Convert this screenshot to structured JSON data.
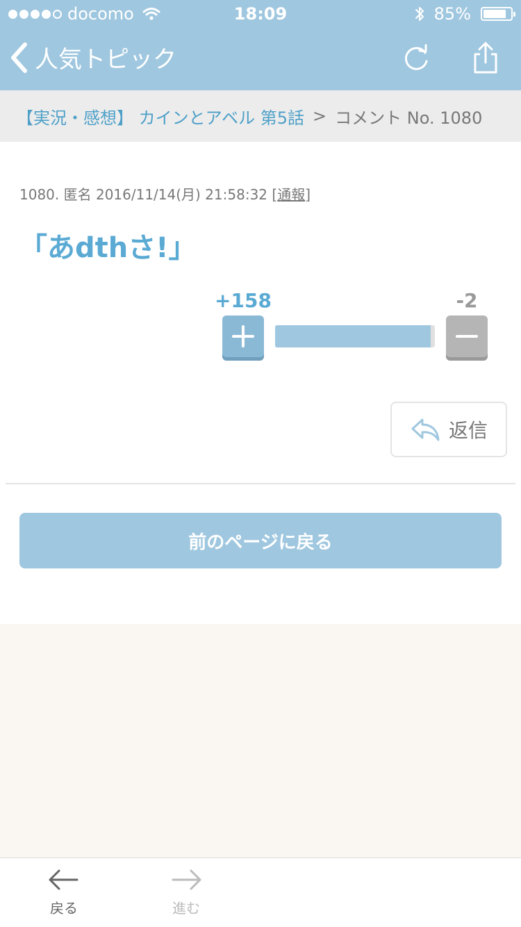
{
  "status_bar": {
    "carrier": "docomo",
    "time": "18:09",
    "battery": "85%",
    "battery_level": 0.85,
    "signal_bars": 4
  },
  "nav": {
    "title": "人気トピック"
  },
  "breadcrumb": {
    "topic_link": "【実況・感想】 カインとアベル 第5話",
    "separator": ">",
    "current": "コメント No. 1080"
  },
  "comment": {
    "meta_text": "1080. 匿名 2016/11/14(月) 21:58:32 [",
    "report_label": "通報",
    "meta_close": "]",
    "text": "「あdthさ!」",
    "plus_count": "+158",
    "minus_count": "-2",
    "plus_ratio": 0.975
  },
  "actions": {
    "reply_label": "返信",
    "prev_page_label": "前のページに戻る"
  },
  "toolbar": {
    "back_label": "戻る",
    "forward_label": "進む"
  }
}
